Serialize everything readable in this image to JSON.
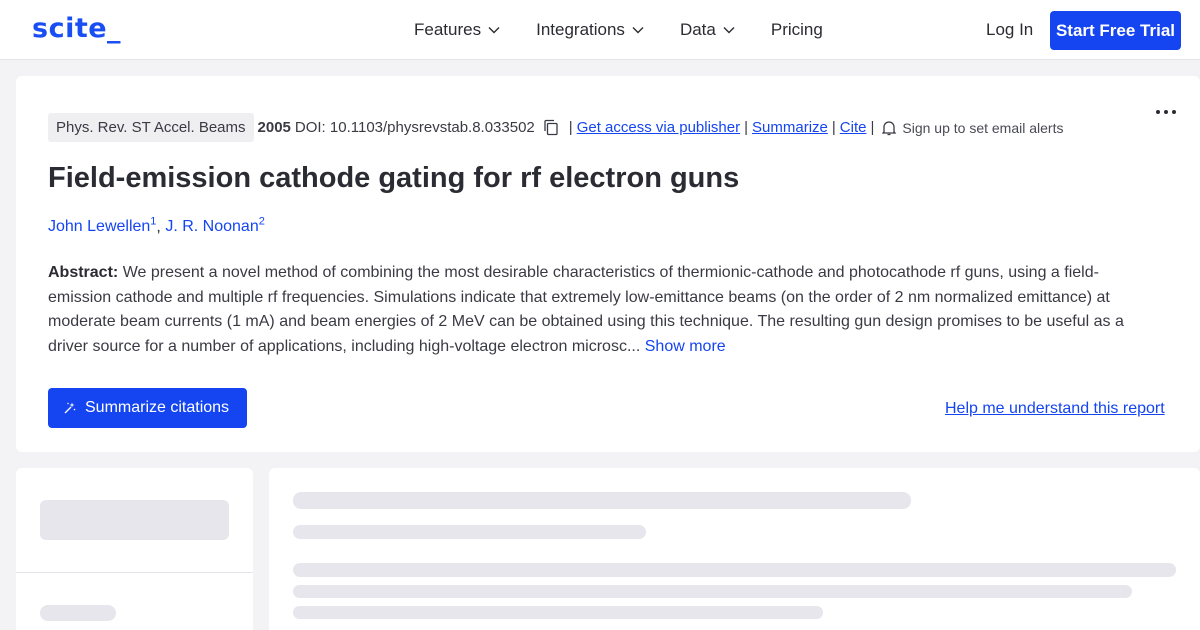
{
  "header": {
    "logo": "scite_",
    "nav": [
      {
        "label": "Features",
        "has_dropdown": true
      },
      {
        "label": "Integrations",
        "has_dropdown": true
      },
      {
        "label": "Data",
        "has_dropdown": true
      },
      {
        "label": "Pricing",
        "has_dropdown": false
      }
    ],
    "login_label": "Log In",
    "trial_label": "Start Free Trial"
  },
  "paper": {
    "journal": "Phys. Rev. ST Accel. Beams",
    "year": "2005",
    "doi": "DOI: 10.1103/physrevstab.8.033502",
    "links": {
      "access": "Get access via publisher",
      "summarize": "Summarize",
      "cite": "Cite"
    },
    "separator": "|",
    "alerts": "Sign up to set email alerts",
    "title": "Field-emission cathode gating for rf electron guns",
    "authors": [
      {
        "name": "John Lewellen",
        "affil": "1"
      },
      {
        "name": "J. R. Noonan",
        "affil": "2"
      }
    ],
    "author_separator": ",",
    "abstract_label": "Abstract:",
    "abstract_text": "We present a novel method of combining the most desirable characteristics of thermionic-cathode and photocathode rf guns, using a field-emission cathode and multiple rf frequencies. Simulations indicate that extremely low-emittance beams (on the order of 2 nm normalized emittance) at moderate beam currents (1 mA) and beam energies of 2 MeV can be obtained using this technique. The resulting gun design promises to be useful as a driver source for a number of applications, including high-voltage electron microsc...",
    "show_more": "Show more",
    "summarize_citations": "Summarize citations",
    "help_link": "Help me understand this report"
  },
  "colors": {
    "accent": "#1545f0",
    "background": "#f3f3f6",
    "skeleton": "#e6e6ec"
  },
  "icons": [
    "chevron-down-icon",
    "copy-icon",
    "bell-icon",
    "more-icon",
    "sparkle-icon"
  ]
}
